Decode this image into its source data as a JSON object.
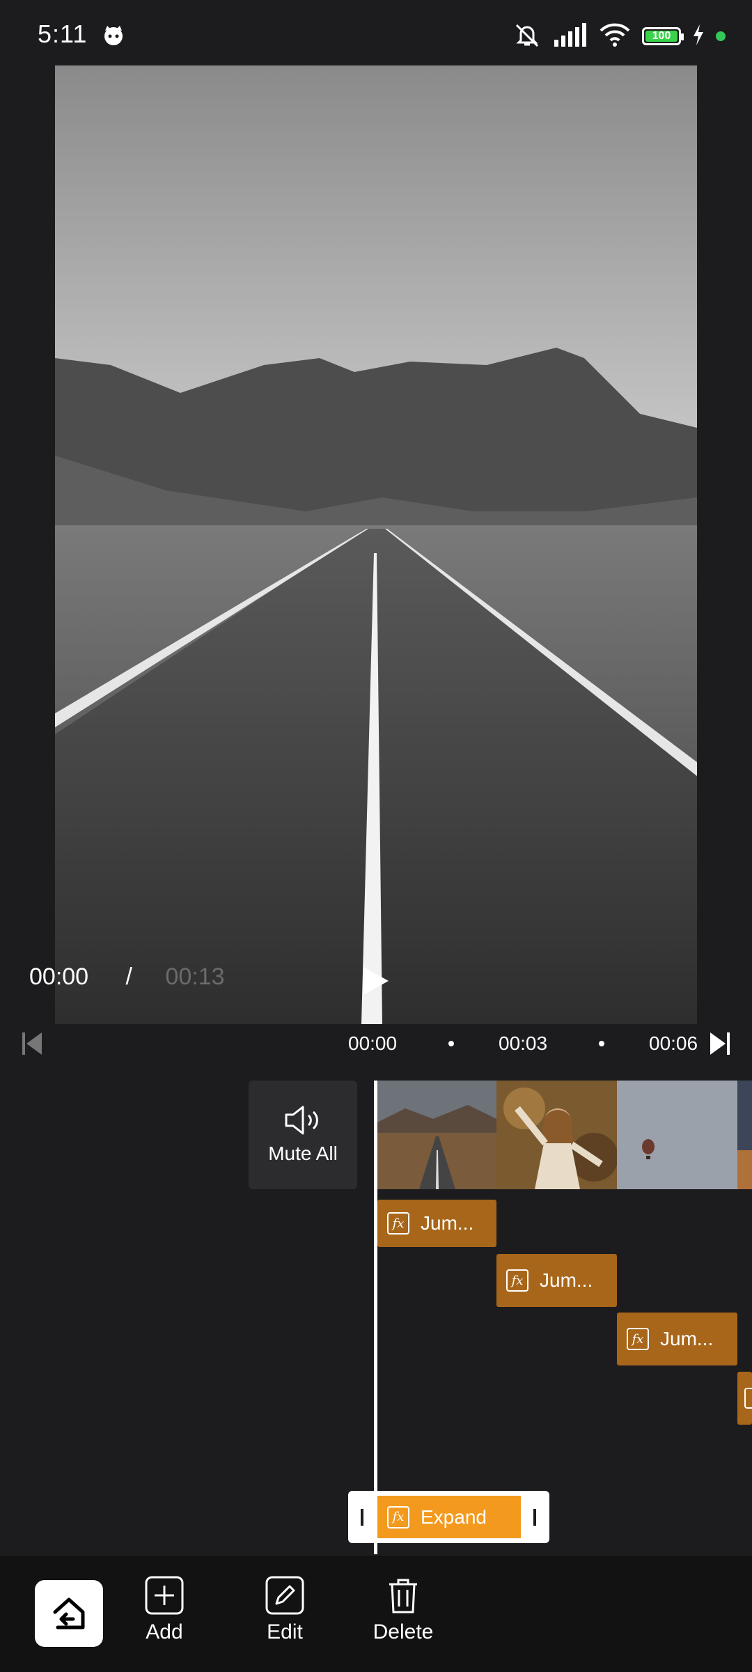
{
  "status_bar": {
    "time": "5:11",
    "battery": "100"
  },
  "player": {
    "current_time": "00:00",
    "separator": "/",
    "total_time": "00:13"
  },
  "ruler": {
    "labels": [
      "00:00",
      "00:03",
      "00:06"
    ]
  },
  "timeline": {
    "mute_all_label": "Mute All",
    "effects": [
      "Jum...",
      "Jum...",
      "Jum..."
    ],
    "selected_effect": "Expand"
  },
  "toolbar": {
    "add_label": "Add",
    "edit_label": "Edit",
    "delete_label": "Delete"
  },
  "colors": {
    "accent": "#f39a1e",
    "effect_chip": "#a8661a",
    "background": "#1c1c1e",
    "battery": "#3ad14b"
  }
}
